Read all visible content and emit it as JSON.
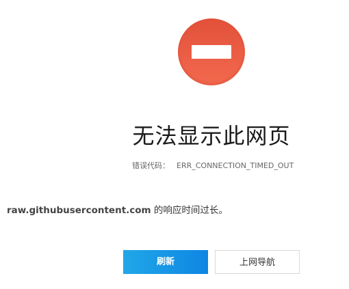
{
  "error_icon": "no-entry-icon",
  "title": "无法显示此网页",
  "error_code": {
    "label": "错误代码：",
    "value": "ERR_CONNECTION_TIMED_OUT"
  },
  "message": {
    "domain": "raw.githubusercontent.com",
    "text": " 的响应时间过长。"
  },
  "buttons": {
    "refresh_label": "刷新",
    "nav_label": "上网导航"
  },
  "colors": {
    "icon_red": "#e2513a",
    "button_blue": "#0e86e3"
  }
}
